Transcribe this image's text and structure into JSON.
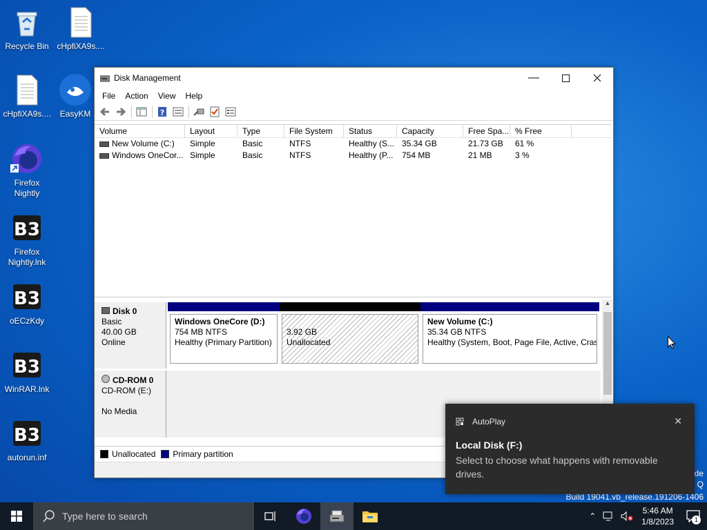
{
  "desktop": {
    "icons": [
      {
        "label": "Recycle Bin",
        "icon": "recycle-bin-icon"
      },
      {
        "label": "cHpfiXA9s....",
        "icon": "document-icon"
      },
      {
        "label": "cHpfiXA9s....",
        "icon": "document-icon"
      },
      {
        "label": "EasyKM",
        "icon": "uc-browser-icon"
      },
      {
        "label": "Firefox Nightly",
        "icon": "firefox-nightly-icon"
      },
      {
        "label": "Firefox Nightly.lnk",
        "icon": "b3-app-icon"
      },
      {
        "label": "oECzKdy",
        "icon": "b3-app-icon"
      },
      {
        "label": "WinRAR.lnk",
        "icon": "b3-app-icon"
      },
      {
        "label": "autorun.inf",
        "icon": "b3-app-icon"
      }
    ]
  },
  "window": {
    "title": "Disk Management",
    "menu": [
      "File",
      "Action",
      "View",
      "Help"
    ],
    "columns": [
      "Volume",
      "Layout",
      "Type",
      "File System",
      "Status",
      "Capacity",
      "Free Spa...",
      "% Free"
    ],
    "rows": [
      [
        "New Volume (C:)",
        "Simple",
        "Basic",
        "NTFS",
        "Healthy (S...",
        "35.34 GB",
        "21.73 GB",
        "61 %"
      ],
      [
        "Windows OneCor...",
        "Simple",
        "Basic",
        "NTFS",
        "Healthy (P...",
        "754 MB",
        "21 MB",
        "3 %"
      ]
    ],
    "disk0": {
      "name": "Disk 0",
      "type": "Basic",
      "size": "40.00 GB",
      "state": "Online",
      "partitions": [
        {
          "name": "Windows OneCore  (D:)",
          "size": "754 MB NTFS",
          "status": "Healthy (Primary Partition)"
        },
        {
          "name": "",
          "size": "3.92 GB",
          "status": "Unallocated"
        },
        {
          "name": "New Volume  (C:)",
          "size": "35.34 GB NTFS",
          "status": "Healthy (System, Boot, Page File, Active, Crash"
        }
      ]
    },
    "cdrom0": {
      "name": "CD-ROM 0",
      "type": "CD-ROM (E:)",
      "state": "No Media"
    },
    "legend": [
      "Unallocated",
      "Primary partition"
    ],
    "colors": {
      "primary": "#000080",
      "unallocated": "#000000"
    }
  },
  "toast": {
    "app": "AutoPlay",
    "title": "Local Disk (F:)",
    "body": "Select to choose what happens with removable drives."
  },
  "watermark": {
    "line1": "de",
    "line2": "Q",
    "line3": "Build 19041.vb_release.191206-1406"
  },
  "taskbar": {
    "search_placeholder": "Type here to search",
    "time": "5:46 AM",
    "date": "1/8/2023",
    "notification_count": "1"
  }
}
